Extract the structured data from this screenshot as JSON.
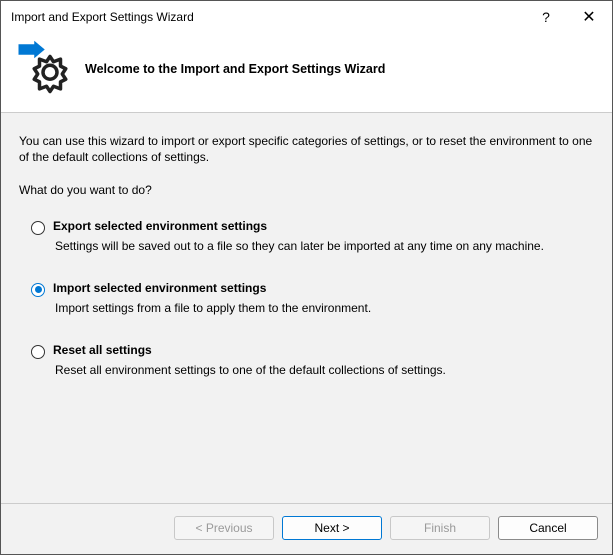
{
  "window": {
    "title": "Import and Export Settings Wizard",
    "help": "?",
    "close": "✕"
  },
  "header": {
    "welcome": "Welcome to the Import and Export Settings Wizard"
  },
  "body": {
    "intro": "You can use this wizard to import or export specific categories of settings, or to reset the environment to one of the default collections of settings.",
    "prompt": "What do you want to do?",
    "options": [
      {
        "title": "Export selected environment settings",
        "desc": "Settings will be saved out to a file so they can later be imported at any time on any machine.",
        "selected": false
      },
      {
        "title": "Import selected environment settings",
        "desc": "Import settings from a file to apply them to the environment.",
        "selected": true
      },
      {
        "title": "Reset all settings",
        "desc": "Reset all environment settings to one of the default collections of settings.",
        "selected": false
      }
    ]
  },
  "footer": {
    "previous": "< Previous",
    "next": "Next >",
    "finish": "Finish",
    "cancel": "Cancel"
  }
}
